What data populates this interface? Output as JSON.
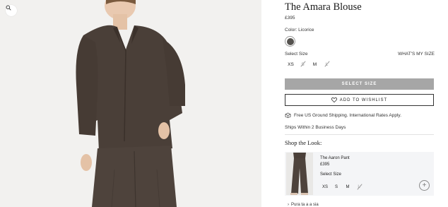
{
  "product": {
    "title": "The Amara Blouse",
    "price": "£395",
    "color_label": "Color: Licorice",
    "color_swatch": "#55534f",
    "size_label": "Select Size",
    "size_guide_label": "WHAT'S MY SIZE",
    "sizes": [
      {
        "label": "XS",
        "available": true
      },
      {
        "label": "S",
        "available": false
      },
      {
        "label": "M",
        "available": true
      },
      {
        "label": "L",
        "available": false
      }
    ],
    "select_size_button": "SELECT SIZE",
    "wishlist_button": "ADD TO WISHLIST",
    "shipping_text": "Free US Ground Shipping. International Rates Apply.",
    "ships_within": "Ships Within 2 Business Days"
  },
  "shop_the_look": {
    "heading": "Shop the Look:",
    "item": {
      "name": "The Aaron Pant",
      "price": "£395",
      "size_label": "Select Size",
      "sizes": [
        {
          "label": "XS",
          "available": true
        },
        {
          "label": "S",
          "available": true
        },
        {
          "label": "M",
          "available": true
        },
        {
          "label": "L",
          "available": false
        }
      ],
      "add_symbol": "+"
    },
    "next_link": "Pura ta a a sia"
  },
  "icons": {
    "zoom": "zoom-icon",
    "heart": "heart-icon",
    "truck": "shipping-icon"
  },
  "colors": {
    "button_disabled": "#a6a6a6",
    "garment": "#4a3f38"
  }
}
